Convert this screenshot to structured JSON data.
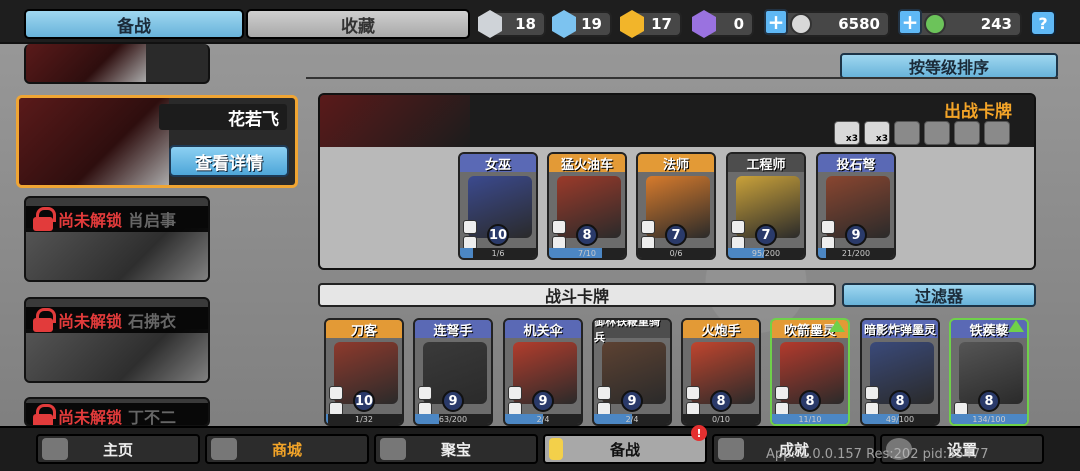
{
  "tabs": {
    "prepare": "备战",
    "collection": "收藏"
  },
  "resources": [
    {
      "icon": "silver-shield-gem-icon",
      "value": "18",
      "color": "#cfd3d8"
    },
    {
      "icon": "blue-shield-gem-icon",
      "value": "19",
      "color": "#7cc3f0"
    },
    {
      "icon": "gold-shield-gem-icon",
      "value": "17",
      "color": "#f2b52a"
    },
    {
      "icon": "purple-shield-gem-icon",
      "value": "0",
      "color": "#9a72e0"
    }
  ],
  "currency": {
    "coins": "6580",
    "gems": "243"
  },
  "heroes": {
    "selected": {
      "name": "花若飞",
      "detail_label": "查看详情"
    },
    "locked": [
      {
        "status": "尚未解锁",
        "name": "肖启事"
      },
      {
        "status": "尚未解锁",
        "name": "石拂衣"
      },
      {
        "status": "尚未解锁",
        "name": "丁不二"
      }
    ]
  },
  "sort_label": "按等级排序",
  "deck": {
    "title": "出战卡牌",
    "skills": [
      {
        "icon": "skull-x3-icon",
        "badge": "x3",
        "active": true
      },
      {
        "icon": "burst-x3-icon",
        "badge": "x3",
        "active": true
      },
      {
        "icon": "tank-icon",
        "active": false
      },
      {
        "icon": "gear-icon",
        "active": false
      },
      {
        "icon": "helmet-icon",
        "active": false
      },
      {
        "icon": "wall-icon",
        "active": false
      }
    ],
    "cards": [
      {
        "name": "女巫",
        "level": "10",
        "progress": "1/6",
        "fill": 0.17,
        "color": "#3b4a8f"
      },
      {
        "name": "猛火油车",
        "level": "8",
        "progress": "7/10",
        "fill": 0.7,
        "color": "#9b3a2a"
      },
      {
        "name": "法师",
        "level": "7",
        "progress": "0/6",
        "fill": 0.0,
        "color": "#d77b2c"
      },
      {
        "name": "工程师",
        "level": "7",
        "progress": "95/200",
        "fill": 0.48,
        "color": "#caa23a"
      },
      {
        "name": "投石弩",
        "level": "9",
        "progress": "21/200",
        "fill": 0.1,
        "color": "#8a4630"
      }
    ]
  },
  "battle": {
    "title": "战斗卡牌",
    "filter_label": "过滤器",
    "cards": [
      {
        "name": "刀客",
        "level": "10",
        "progress": "1/32",
        "fill": 0.03,
        "color": "#8e3a2d",
        "upgrade": false
      },
      {
        "name": "连弩手",
        "level": "9",
        "progress": "63/200",
        "fill": 0.31,
        "color": "#3a3a3a",
        "upgrade": false
      },
      {
        "name": "机关伞",
        "level": "9",
        "progress": "2/4",
        "fill": 0.5,
        "color": "#b23d2d",
        "upgrade": false
      },
      {
        "name": "御林铁鞭重骑兵",
        "level": "9",
        "progress": "2/4",
        "fill": 0.5,
        "color": "#5d4232",
        "upgrade": false
      },
      {
        "name": "火炮手",
        "level": "8",
        "progress": "0/10",
        "fill": 0.0,
        "color": "#c0452e",
        "upgrade": false
      },
      {
        "name": "吹箭墨灵",
        "level": "8",
        "progress": "11/10",
        "fill": 1.0,
        "color": "#b33a2c",
        "upgrade": true
      },
      {
        "name": "暗影炸弹墨灵",
        "level": "8",
        "progress": "49/100",
        "fill": 0.49,
        "color": "#3a4a7a",
        "upgrade": false
      },
      {
        "name": "铁蒺藜",
        "level": "8",
        "progress": "134/100",
        "fill": 1.0,
        "color": "#555555",
        "upgrade": true
      }
    ]
  },
  "nav": [
    {
      "label": "主页",
      "icon": "home-icon",
      "active": false
    },
    {
      "label": "商城",
      "icon": "shop-coins-icon",
      "active": false
    },
    {
      "label": "聚宝",
      "icon": "treasure-icon",
      "active": false
    },
    {
      "label": "备战",
      "icon": "cards-icon",
      "active": true
    },
    {
      "label": "成就",
      "icon": "achievement-icon",
      "active": false
    },
    {
      "label": "设置",
      "icon": "gear-icon",
      "active": false
    }
  ],
  "nav_badge": "!",
  "version_text": "App: 1.0.0.157 Res:202 pid:35477"
}
